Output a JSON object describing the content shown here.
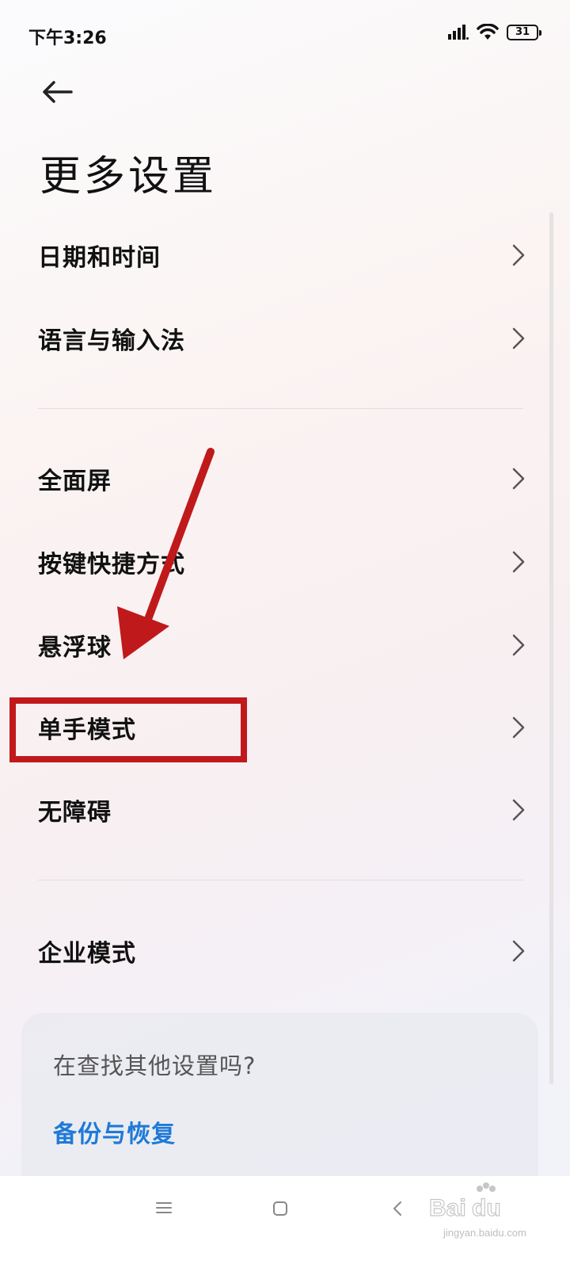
{
  "status_bar": {
    "time": "下午3:26",
    "battery_level": "31",
    "icons": [
      "signal-icon",
      "wifi-icon",
      "battery-icon"
    ]
  },
  "header": {
    "back_icon": "arrow-left-icon",
    "title": "更多设置"
  },
  "settings": {
    "items": [
      {
        "label": "日期和时间"
      },
      {
        "label": "语言与输入法"
      },
      {
        "label": "全面屏"
      },
      {
        "label": "按键快捷方式"
      },
      {
        "label": "悬浮球"
      },
      {
        "label": "单手模式"
      },
      {
        "label": "无障碍"
      },
      {
        "label": "企业模式"
      }
    ]
  },
  "suggest_card": {
    "question": "在查找其他设置吗?",
    "link": "备份与恢复"
  },
  "nav_bar": {
    "icons": [
      "menu-icon",
      "home-icon",
      "back-triangle-icon"
    ]
  },
  "watermark": {
    "text": "jingyan.baidu.com"
  },
  "colors": {
    "annotation_red": "#c0191b",
    "link_blue": "#1f7ad8",
    "text_primary": "#111111"
  }
}
